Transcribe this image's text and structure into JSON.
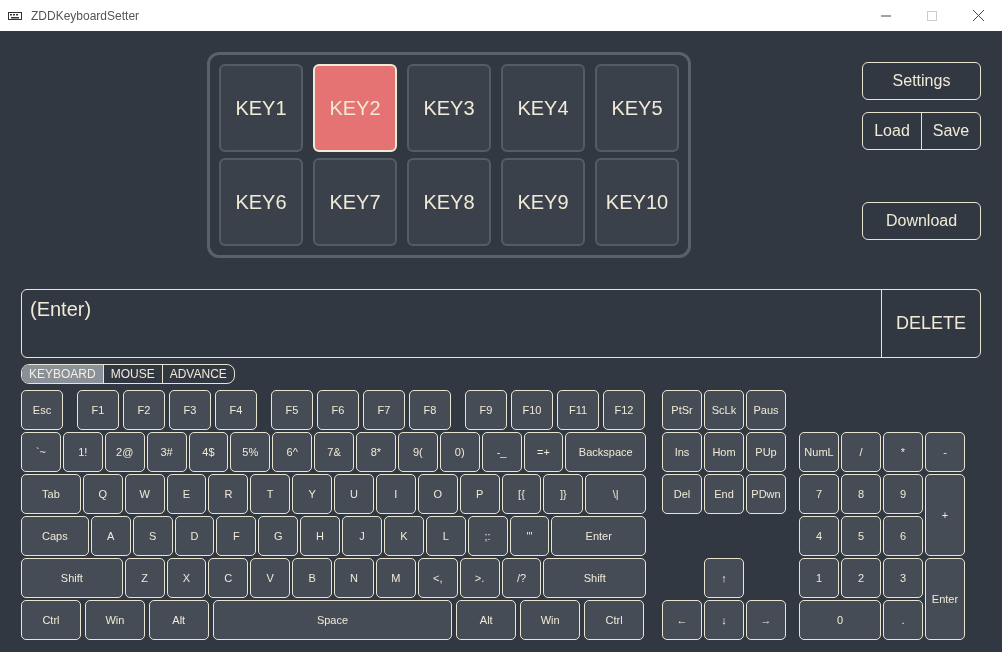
{
  "window": {
    "title": "ZDDKeyboardSetter"
  },
  "macro_keys": [
    {
      "label": "KEY1",
      "selected": false
    },
    {
      "label": "KEY2",
      "selected": true
    },
    {
      "label": "KEY3",
      "selected": false
    },
    {
      "label": "KEY4",
      "selected": false
    },
    {
      "label": "KEY5",
      "selected": false
    },
    {
      "label": "KEY6",
      "selected": false
    },
    {
      "label": "KEY7",
      "selected": false
    },
    {
      "label": "KEY8",
      "selected": false
    },
    {
      "label": "KEY9",
      "selected": false
    },
    {
      "label": "KEY10",
      "selected": false
    }
  ],
  "buttons": {
    "settings": "Settings",
    "load": "Load",
    "save": "Save",
    "download": "Download"
  },
  "macro_input": {
    "value": "(Enter)"
  },
  "delete_button": "DELETE",
  "tabs": [
    {
      "label": "KEYBOARD",
      "selected": true
    },
    {
      "label": "MOUSE",
      "selected": false
    },
    {
      "label": "ADVANCE",
      "selected": false
    }
  ],
  "keyboard": {
    "main_rows": [
      [
        "Esc",
        "F1",
        "F2",
        "F3",
        "F4",
        "F5",
        "F6",
        "F7",
        "F8",
        "F9",
        "F10",
        "F11",
        "F12"
      ],
      [
        "`~",
        "1!",
        "2@",
        "3#",
        "4$",
        "5%",
        "6^",
        "7&",
        "8*",
        "9(",
        "0)",
        "-_",
        "=+",
        "Backspace"
      ],
      [
        "Tab",
        "Q",
        "W",
        "E",
        "R",
        "T",
        "Y",
        "U",
        "I",
        "O",
        "P",
        "[{",
        "]}",
        "\\|"
      ],
      [
        "Caps",
        "A",
        "S",
        "D",
        "F",
        "G",
        "H",
        "J",
        "K",
        "L",
        ";:",
        "'\"",
        "Enter"
      ],
      [
        "Shift",
        "Z",
        "X",
        "C",
        "V",
        "B",
        "N",
        "M",
        "<,",
        ">.",
        "/?",
        "Shift"
      ],
      [
        "Ctrl",
        "Win",
        "Alt",
        "Space",
        "Alt",
        "Win",
        "Ctrl"
      ]
    ],
    "nav_keys": [
      "PtSr",
      "ScLk",
      "Paus",
      "Ins",
      "Hom",
      "PUp",
      "Del",
      "End",
      "PDwn"
    ],
    "arrow_keys": [
      "↑",
      "←",
      "↓",
      "→"
    ],
    "numpad": [
      "NumL",
      "/",
      "*",
      "-",
      "7",
      "8",
      "9",
      "+",
      "4",
      "5",
      "6",
      "1",
      "2",
      "3",
      "Enter",
      "0",
      "."
    ]
  }
}
